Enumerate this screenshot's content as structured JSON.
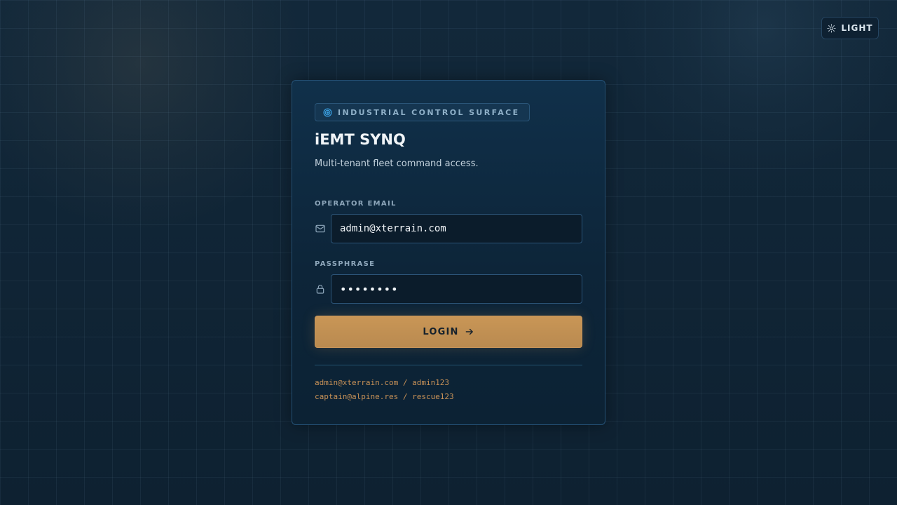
{
  "theme_toggle": {
    "label": "LIGHT",
    "icon": "sun-icon"
  },
  "login_card": {
    "badge": {
      "label": "INDUSTRIAL CONTROL SURFACE",
      "icon": "target-icon"
    },
    "title": "iEMT SYNQ",
    "subtitle": "Multi-tenant fleet command access.",
    "email": {
      "label": "OPERATOR EMAIL",
      "value": "admin@xterrain.com",
      "icon": "mail-icon"
    },
    "passphrase": {
      "label": "PASSPHRASE",
      "value": "••••••••",
      "icon": "lock-icon"
    },
    "login_button": {
      "label": "LOGIN",
      "icon": "arrow-right-icon"
    },
    "credential_hints": [
      "admin@xterrain.com / admin123",
      "captain@alpine.res / rescue123"
    ]
  },
  "colors": {
    "accent": "#c99656",
    "background": "#0f2233",
    "card": "#0d2539",
    "hint_text": "#c79157"
  }
}
